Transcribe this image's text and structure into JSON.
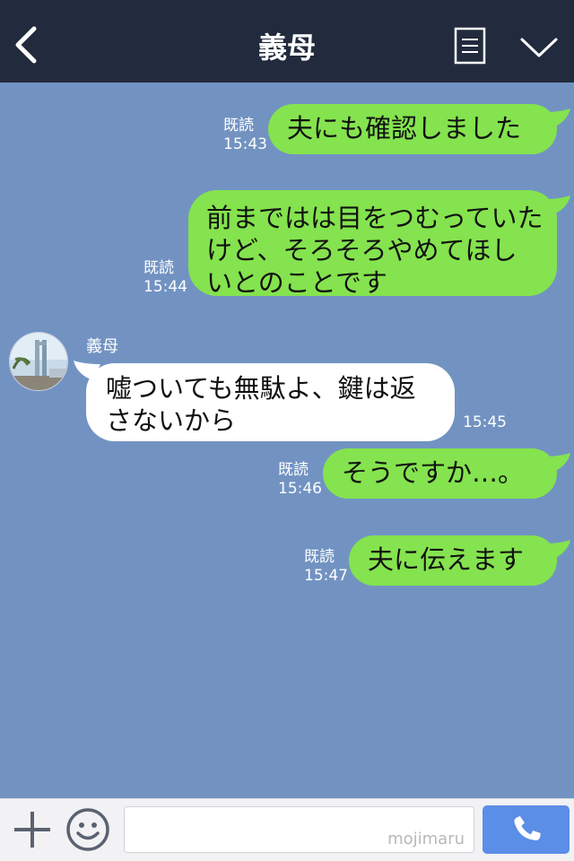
{
  "header": {
    "title": "義母",
    "back_icon": "chevron-left-icon",
    "menu_icon": "notes-icon",
    "dropdown_icon": "chevron-down-icon"
  },
  "messages": [
    {
      "side": "out",
      "text_lines": [
        "夫にも確認しました"
      ],
      "read": "既読",
      "time": "15:43"
    },
    {
      "side": "out",
      "text_lines": [
        "前まではは目をつむっていた",
        "けど、そろそろやめてほし",
        "いとのことです"
      ],
      "read": "既読",
      "time": "15:44"
    },
    {
      "side": "in",
      "sender": "義母",
      "text_lines": [
        "嘘ついても無駄よ、鍵は返",
        "さないから"
      ],
      "time": "15:45"
    },
    {
      "side": "out",
      "text_lines": [
        "そうですか…。"
      ],
      "read": "既読",
      "time": "15:46"
    },
    {
      "side": "out",
      "text_lines": [
        "夫に伝えます"
      ],
      "read": "既読",
      "time": "15:47"
    }
  ],
  "footer": {
    "plus_icon": "plus-icon",
    "emoji_icon": "smiley-icon",
    "input_value": "",
    "watermark": "mojimaru",
    "call_icon": "phone-icon"
  },
  "colors": {
    "header_bg": "#222b3d",
    "chat_bg": "#7293c2",
    "outgoing_bubble": "#84e34e",
    "incoming_bubble": "#ffffff",
    "call_button": "#5b8ee6"
  }
}
